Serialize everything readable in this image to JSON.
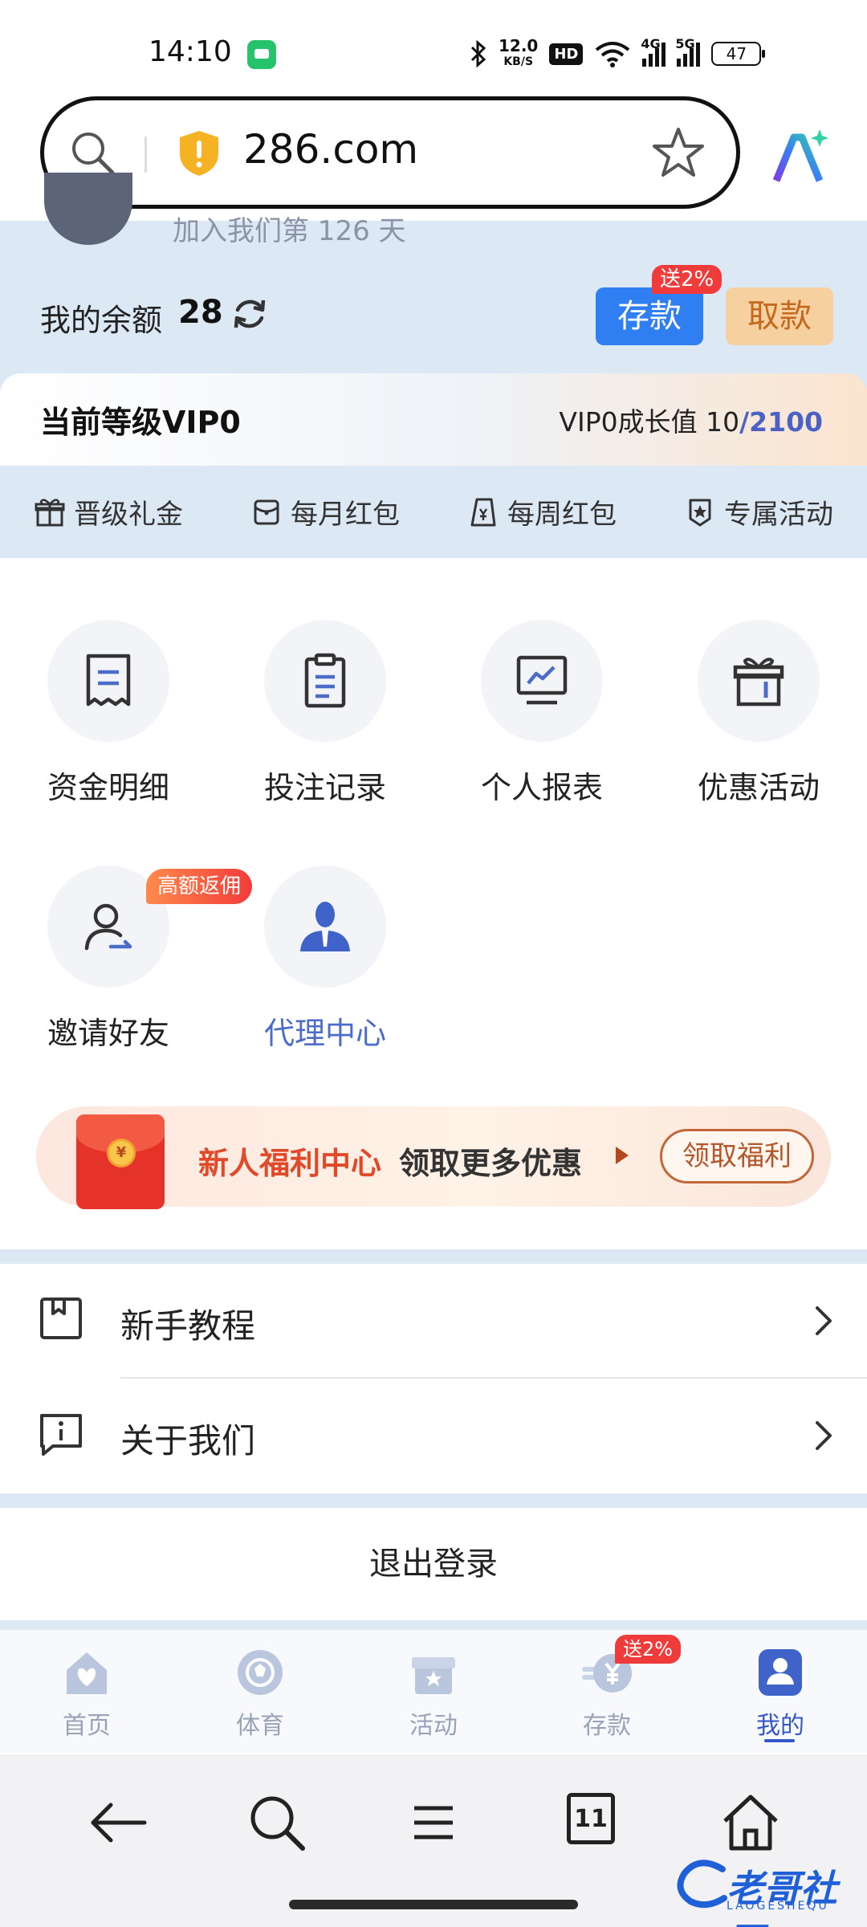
{
  "status_bar": {
    "time": "14:10",
    "net_speed_value": "12.0",
    "net_speed_unit": "KB/S",
    "hd_label": "HD",
    "sim1_tag": "4G",
    "sim2_tag": "5G",
    "battery": "47"
  },
  "address_bar": {
    "url": "286.com"
  },
  "profile": {
    "join_text": "加入我们第 126 天"
  },
  "balance": {
    "label": "我的余额",
    "value": "28",
    "deposit_label": "存款",
    "deposit_badge": "送2%",
    "withdraw_label": "取款"
  },
  "vip": {
    "level_label": "当前等级VIP0",
    "growth_label": "VIP0成长值",
    "growth_current": "10",
    "growth_max": "/2100"
  },
  "perks": [
    {
      "label": "晋级礼金",
      "icon": "gift-icon"
    },
    {
      "label": "每月红包",
      "icon": "envelope-icon"
    },
    {
      "label": "每周红包",
      "icon": "red-packet-icon"
    },
    {
      "label": "专属活动",
      "icon": "star-badge-icon"
    }
  ],
  "grid": [
    {
      "label": "资金明细",
      "icon": "receipt-icon"
    },
    {
      "label": "投注记录",
      "icon": "clipboard-icon"
    },
    {
      "label": "个人报表",
      "icon": "chart-monitor-icon"
    },
    {
      "label": "优惠活动",
      "icon": "gift-box-icon"
    },
    {
      "label": "邀请好友",
      "icon": "invite-user-icon",
      "badge": "高额返佣"
    },
    {
      "label": "代理中心",
      "icon": "agent-icon"
    }
  ],
  "promo": {
    "title": "新人福利中心",
    "subtitle": "领取更多优惠",
    "button": "领取福利",
    "coin_symbol": "¥"
  },
  "menu": [
    {
      "label": "新手教程",
      "icon": "book-icon"
    },
    {
      "label": "关于我们",
      "icon": "info-icon"
    }
  ],
  "logout_label": "退出登录",
  "tabs": [
    {
      "label": "首页",
      "icon": "home-icon"
    },
    {
      "label": "体育",
      "icon": "sports-ball-icon"
    },
    {
      "label": "活动",
      "icon": "activity-gift-icon"
    },
    {
      "label": "存款",
      "icon": "deposit-coin-icon",
      "badge": "送2%"
    },
    {
      "label": "我的",
      "icon": "profile-icon",
      "active": true
    }
  ],
  "browser_nav": {
    "tab_count": "11"
  },
  "watermark": {
    "text": "老哥社区",
    "sub": "LAOGESHEQU"
  },
  "colors": {
    "accent_blue": "#2f7ff2",
    "header_bg": "#dde8f5",
    "active_tab": "#3558c7",
    "badge_red": "#f03b3b",
    "withdraw_bg": "#f6d19f"
  }
}
